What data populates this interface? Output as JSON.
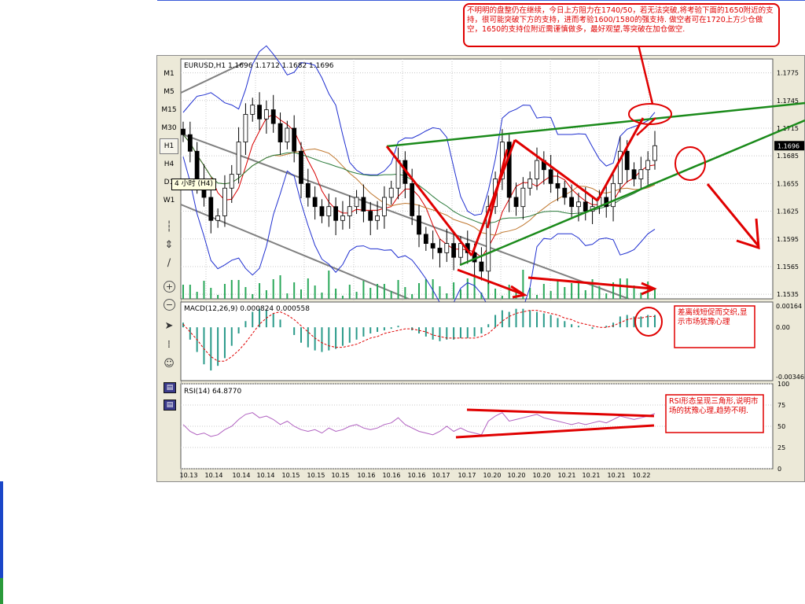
{
  "timeframes": [
    "M1",
    "M5",
    "M15",
    "M30",
    "H1",
    "H4",
    "D1",
    "W1"
  ],
  "active_timeframe": "H1",
  "timeframe_tooltip": "4 小时 (H4)",
  "toolbar_icons": [
    "line-tool-icon",
    "arrow-tool-icon",
    "pencil-tool-icon",
    "zoom-in-icon",
    "zoom-out-icon",
    "autoscroll-icon",
    "chart-shift-icon",
    "expert-icon",
    "template-icon",
    "template-save-icon"
  ],
  "zoom_in_glyph": "+",
  "zoom_out_glyph": "−",
  "annotations": {
    "top": "不明明的盘整仍在继续，今日上方阻力在1740/50，若无法突破,将考验下面的1650附近的支持，很可能突破下方的支持，进而考验1600/1580的强支持. 做空者可在1720上方少仓做空，1650的支持位附近需谨慎做多，最好观望,等突破在加仓做空.",
    "macd": "差离线短促而交织,显示市场犹豫心理",
    "rsi": "RSI形态呈现三角形,说明市场的犹豫心理,趋势不明."
  },
  "colors": {
    "candle": "#000000",
    "bollinger": "#1f2fd0",
    "ma_fast": "#d80000",
    "ma_mid": "#c07830",
    "ma_slow": "#2a7a3a",
    "volume": "#2aa85a",
    "macd_hist": "#2a9a8a",
    "macd_signal": "#e00000",
    "rsi": "#b060c0",
    "annotation": "#e00000",
    "trendline_green": "#1a8a1a",
    "channel_gray": "#808080"
  },
  "chart_data": [
    {
      "type": "candlestick",
      "title": "EURUSD,H1  1.1696 1.1712 1.1682 1.1696",
      "symbol": "EURUSD,H1",
      "ohlc_header": "1.1696 1.1712 1.1682 1.1696",
      "current_price": "1.1696",
      "ylim": [
        1.153,
        1.179
      ],
      "y_ticks": [
        "1.1775",
        "1.1745",
        "1.1715",
        "1.1685",
        "1.1655",
        "1.1625",
        "1.1595",
        "1.1565",
        "1.1535"
      ],
      "x_ticks": [
        "10.13",
        "10.14",
        "10.14",
        "10.14",
        "10.15",
        "10.15",
        "10.15",
        "10.16",
        "10.16",
        "10.16",
        "10.17",
        "10.17",
        "10.20",
        "10.20",
        "10.20",
        "10.21",
        "10.21",
        "10.21",
        "10.22"
      ],
      "series": [
        {
          "name": "close",
          "values": [
            1.1708,
            1.169,
            1.166,
            1.164,
            1.1615,
            1.162,
            1.165,
            1.1665,
            1.17,
            1.173,
            1.174,
            1.1725,
            1.1735,
            1.172,
            1.17,
            1.1715,
            1.169,
            1.1655,
            1.164,
            1.163,
            1.162,
            1.163,
            1.1615,
            1.162,
            1.163,
            1.164,
            1.1625,
            1.1615,
            1.162,
            1.164,
            1.165,
            1.168,
            1.1655,
            1.162,
            1.16,
            1.159,
            1.1585,
            1.158,
            1.159,
            1.1575,
            1.159,
            1.158,
            1.157,
            1.156,
            1.163,
            1.166,
            1.17,
            1.164,
            1.163,
            1.165,
            1.166,
            1.168,
            1.167,
            1.1655,
            1.165,
            1.164,
            1.163,
            1.1635,
            1.1625,
            1.163,
            1.164,
            1.163,
            1.1655,
            1.169,
            1.167,
            1.166,
            1.167,
            1.168,
            1.1696
          ]
        }
      ]
    },
    {
      "type": "line",
      "title": "MACD(12,26,9)  0.000824 0.000558",
      "indicator": "MACD(12,26,9)",
      "values_header": "0.000824 0.000558",
      "ylim": [
        -0.00346,
        0.00164
      ],
      "y_ticks": [
        "0.00164",
        "0.00",
        "-0.00346"
      ],
      "series": [
        {
          "name": "histogram",
          "values": [
            0.0003,
            -0.0008,
            -0.0016,
            -0.0024,
            -0.0028,
            -0.0025,
            -0.002,
            -0.0012,
            -0.0004,
            0.0004,
            0.001,
            0.0012,
            0.0011,
            0.0009,
            0.0005,
            0.0,
            -0.0005,
            -0.001,
            -0.0013,
            -0.0015,
            -0.0016,
            -0.0015,
            -0.0014,
            -0.0012,
            -0.001,
            -0.0008,
            -0.0006,
            -0.0004,
            -0.0003,
            -0.0002,
            -0.0001,
            0.0001,
            0.0,
            -0.0002,
            -0.0004,
            -0.0006,
            -0.0008,
            -0.0009,
            -0.0008,
            -0.0008,
            -0.0007,
            -0.0007,
            -0.0006,
            -0.0004,
            0.0002,
            0.0008,
            0.0011,
            0.001,
            0.0012,
            0.0012,
            0.0011,
            0.001,
            0.0009,
            0.0008,
            0.0006,
            0.0004,
            0.0002,
            0.0001,
            0.0,
            -0.0001,
            0.0,
            0.0001,
            0.0003,
            0.0007,
            0.0008,
            0.0007,
            0.0007,
            0.0008,
            0.0008
          ]
        },
        {
          "name": "signal",
          "values": [
            0.0002,
            -0.0003,
            -0.0008,
            -0.0014,
            -0.0019,
            -0.0022,
            -0.0022,
            -0.0019,
            -0.0015,
            -0.001,
            -0.0004,
            0.0002,
            0.0006,
            0.0009,
            0.001,
            0.0008,
            0.0005,
            0.0001,
            -0.0003,
            -0.0007,
            -0.001,
            -0.0012,
            -0.0013,
            -0.0013,
            -0.0012,
            -0.0011,
            -0.0009,
            -0.0007,
            -0.0006,
            -0.0004,
            -0.0003,
            -0.0002,
            -0.0001,
            -0.0001,
            -0.0002,
            -0.0003,
            -0.0005,
            -0.0006,
            -0.0007,
            -0.0007,
            -0.0007,
            -0.0007,
            -0.0007,
            -0.0006,
            -0.0004,
            0.0,
            0.0004,
            0.0007,
            0.0009,
            0.001,
            0.0011,
            0.0011,
            0.001,
            0.0009,
            0.0008,
            0.0006,
            0.0005,
            0.0003,
            0.0002,
            0.0001,
            0.0,
            0.0,
            0.0001,
            0.0003,
            0.0005,
            0.0006,
            0.0006,
            0.0007,
            0.0007
          ]
        }
      ]
    },
    {
      "type": "line",
      "title": "RSI(14)  64.8770",
      "indicator": "RSI(14)",
      "values_header": "64.8770",
      "ylim": [
        0,
        100
      ],
      "y_ticks": [
        "100",
        "75",
        "50",
        "25",
        "0"
      ],
      "series": [
        {
          "name": "RSI",
          "values": [
            52,
            44,
            40,
            42,
            38,
            40,
            46,
            50,
            58,
            64,
            66,
            60,
            62,
            58,
            52,
            56,
            50,
            46,
            44,
            46,
            42,
            48,
            44,
            46,
            50,
            52,
            48,
            46,
            48,
            52,
            54,
            60,
            52,
            48,
            44,
            42,
            40,
            44,
            50,
            44,
            48,
            44,
            42,
            40,
            56,
            62,
            66,
            56,
            58,
            60,
            62,
            64,
            60,
            58,
            56,
            54,
            52,
            54,
            52,
            54,
            56,
            54,
            58,
            62,
            60,
            58,
            60,
            62,
            64.877
          ]
        }
      ]
    }
  ]
}
